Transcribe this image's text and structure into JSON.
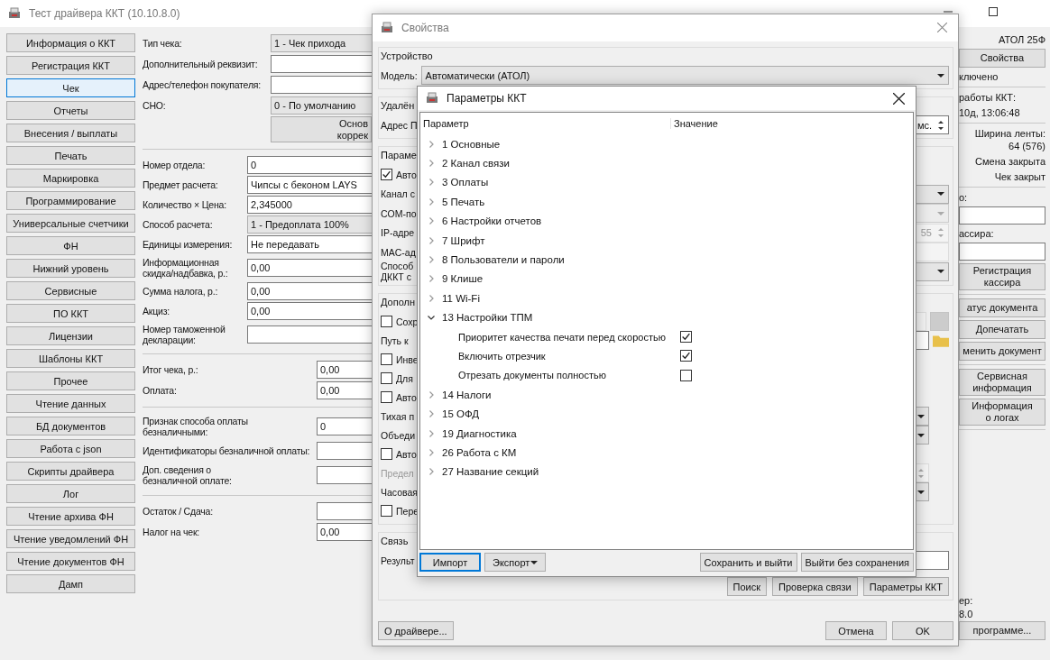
{
  "main_window": {
    "title": "Тест драйвера ККТ (10.10.8.0)",
    "nav": [
      {
        "label": "Информация о ККТ",
        "selected": false
      },
      {
        "label": "Регистрация ККТ",
        "selected": false
      },
      {
        "label": "Чек",
        "selected": true
      },
      {
        "label": "Отчеты",
        "selected": false
      },
      {
        "label": "Внесения / выплаты",
        "selected": false
      },
      {
        "label": "Печать",
        "selected": false
      },
      {
        "label": "Маркировка",
        "selected": false
      },
      {
        "label": "Программирование",
        "selected": false
      },
      {
        "label": "Универсальные счетчики",
        "selected": false
      },
      {
        "label": "ФН",
        "selected": false
      },
      {
        "label": "Нижний уровень",
        "selected": false
      },
      {
        "label": "Сервисные",
        "selected": false
      },
      {
        "label": "ПО ККТ",
        "selected": false
      },
      {
        "label": "Лицензии",
        "selected": false
      },
      {
        "label": "Шаблоны ККТ",
        "selected": false
      },
      {
        "label": "Прочее",
        "selected": false
      },
      {
        "label": "Чтение данных",
        "selected": false
      },
      {
        "label": "БД документов",
        "selected": false
      },
      {
        "label": "Работа с json",
        "selected": false
      },
      {
        "label": "Скрипты драйвера",
        "selected": false
      },
      {
        "label": "Лог",
        "selected": false
      },
      {
        "label": "Чтение архива ФН",
        "selected": false
      },
      {
        "label": "Чтение уведомлений ФН",
        "selected": false
      },
      {
        "label": "Чтение документов ФН",
        "selected": false
      },
      {
        "label": "Дамп",
        "selected": false
      }
    ],
    "form_groups": [
      {
        "rows": [
          {
            "label": "Тип чека:",
            "kind": "combo",
            "value": "1 - Чек прихода"
          },
          {
            "label": "Дополнительный реквизит:",
            "kind": "input"
          },
          {
            "label": "Адрес/телефон покупателя:",
            "kind": "input"
          },
          {
            "label": "СНО:",
            "kind": "combo",
            "value": "0 - По умолчанию"
          }
        ],
        "button": "Основ\nкоррек"
      },
      {
        "rows": [
          {
            "label": "Номер отдела:",
            "kind": "input",
            "value": "0"
          },
          {
            "label": "Предмет расчета:",
            "kind": "input",
            "value": "Чипсы с беконом LAYS"
          },
          {
            "label": "Количество × Цена:",
            "kind": "input",
            "value": "2,345000"
          },
          {
            "label": "Способ расчета:",
            "kind": "combo",
            "value": "1 - Предоплата 100%"
          },
          {
            "label": "Единицы измерения:",
            "kind": "input",
            "value": "Не передавать"
          },
          {
            "label": "Информационная\nскидка/надбавка, р.:",
            "kind": "input",
            "value": "0,00"
          },
          {
            "label": "Сумма налога, р.:",
            "kind": "input",
            "value": "0,00"
          },
          {
            "label": "Акциз:",
            "kind": "input",
            "value": "0,00"
          },
          {
            "label": "Номер таможенной\nдекларации:",
            "kind": "input"
          }
        ]
      },
      {
        "rows": [
          {
            "label": "Итог чека, р.:",
            "kind": "input",
            "value": "0,00"
          },
          {
            "label": "Оплата:",
            "kind": "input",
            "value": "0,00"
          }
        ]
      },
      {
        "rows": [
          {
            "label": "Признак способа оплаты\nбезналичными:",
            "kind": "input",
            "value": "0"
          },
          {
            "label": "Идентификаторы безналичной оплаты:",
            "kind": "input"
          },
          {
            "label": "Доп. сведения о\nбезналичной оплате:",
            "kind": "input"
          }
        ]
      },
      {
        "rows": [
          {
            "label": "Остаток / Сдача:",
            "kind": "input"
          },
          {
            "label": "Налог на чек:",
            "kind": "input",
            "value": "0,00"
          }
        ]
      }
    ],
    "right_panel": [
      [
        {
          "kind": "text_right",
          "text": "АТОЛ 25Ф"
        },
        {
          "kind": "button",
          "text": "Свойства"
        },
        {
          "kind": "text",
          "text": "ключено"
        }
      ],
      [
        {
          "kind": "text",
          "text": "работы ККТ:"
        },
        {
          "kind": "text",
          "text": "10д, 13:06:48"
        }
      ],
      [
        {
          "kind": "text_right",
          "text": "Ширина ленты:\n64 (576)"
        },
        {
          "kind": "text_right",
          "text": "Смена закрыта"
        },
        {
          "kind": "text_right",
          "text": "Чек закрыт"
        }
      ],
      [
        {
          "kind": "text",
          "text": "о:"
        },
        {
          "kind": "input"
        },
        {
          "kind": "text",
          "text": "ассира:"
        },
        {
          "kind": "input"
        },
        {
          "kind": "button",
          "text": "Регистрация\nкассира"
        }
      ],
      [
        {
          "kind": "button",
          "text": "атус документа"
        },
        {
          "kind": "button",
          "text": "Допечатать"
        },
        {
          "kind": "button",
          "text": "менить документ"
        }
      ],
      [
        {
          "kind": "button",
          "text": "Сервисная\nинформация"
        },
        {
          "kind": "button",
          "text": "Информация\nо логах"
        }
      ]
    ],
    "right_footer": [
      {
        "kind": "text",
        "text": "ер:"
      },
      {
        "kind": "text",
        "text": "8.0"
      },
      {
        "kind": "button",
        "text": "программе..."
      }
    ]
  },
  "properties_dialog": {
    "title": "Свойства",
    "groups": [
      {
        "title": "Устройство",
        "rows": [
          {
            "kind": "label",
            "label": "Модель:",
            "control": {
              "kind": "combo",
              "value": "Автоматически (АТОЛ)"
            }
          }
        ]
      },
      {
        "title": "Удалён",
        "rows": [
          {
            "kind": "label",
            "label": "Адрес П",
            "control": {
              "kind": "spin",
              "value": "мс."
            }
          }
        ]
      },
      {
        "title": "Параме",
        "rows": [
          {
            "kind": "checkbox",
            "label": "Авто",
            "checked": true
          },
          {
            "kind": "label",
            "label": "Канал с",
            "control": {
              "kind": "combo"
            }
          },
          {
            "kind": "label",
            "label": "COM-по",
            "control": {
              "kind": "combo",
              "disabled": true
            }
          },
          {
            "kind": "label",
            "label": "IP-адре",
            "control": {
              "kind": "spin",
              "value": "55",
              "disabled": true
            }
          },
          {
            "kind": "label",
            "label": "MAC-ад",
            "control": {
              "kind": "input",
              "disabled": true
            }
          },
          {
            "kind": "label",
            "label": "Способ\nДККТ с",
            "control": {
              "kind": "combo"
            }
          }
        ]
      },
      {
        "title": "Дополн",
        "rows": [
          {
            "kind": "checkbox",
            "label": "Сохр",
            "checked": false,
            "control": {
              "kind": "input_button",
              "disabled": true
            }
          },
          {
            "kind": "label",
            "label": "Путь к",
            "control": {
              "kind": "input_folder"
            }
          },
          {
            "kind": "checkbox",
            "label": "Инве",
            "checked": false
          },
          {
            "kind": "checkbox",
            "label": "Для",
            "checked": false
          },
          {
            "kind": "checkbox",
            "label": "Авто",
            "checked": false
          },
          {
            "kind": "label",
            "label": "Тихая п",
            "control": {
              "kind": "combo"
            }
          },
          {
            "kind": "label",
            "label": "Объеди",
            "control": {
              "kind": "combo"
            }
          },
          {
            "kind": "checkbox",
            "label": "Авто",
            "checked": false
          },
          {
            "kind": "label",
            "label": "Предел",
            "disabled": true,
            "control": {
              "kind": "spin",
              "disabled": true
            }
          },
          {
            "kind": "label",
            "label": "Часовая",
            "control": {
              "kind": "combo"
            }
          },
          {
            "kind": "checkbox",
            "label": "Пере",
            "checked": false
          }
        ]
      },
      {
        "title": "Связь",
        "rows": [
          {
            "kind": "label",
            "label": "Результ",
            "control": {
              "kind": "input"
            }
          }
        ],
        "buttons": [
          "Поиск",
          "Проверка связи",
          "Параметры ККТ"
        ]
      }
    ],
    "about_button": "О драйвере...",
    "buttons": [
      "Отмена",
      "OK"
    ]
  },
  "params_dialog": {
    "title": "Параметры ККТ",
    "columns": [
      "Параметр",
      "Значение"
    ],
    "tree": [
      {
        "label": "1 Основные",
        "expanded": false
      },
      {
        "label": "2 Канал связи",
        "expanded": false
      },
      {
        "label": "3 Оплаты",
        "expanded": false
      },
      {
        "label": "5 Печать",
        "expanded": false
      },
      {
        "label": "6 Настройки отчетов",
        "expanded": false
      },
      {
        "label": "7 Шрифт",
        "expanded": false
      },
      {
        "label": "8 Пользователи и пароли",
        "expanded": false
      },
      {
        "label": "9 Клише",
        "expanded": false
      },
      {
        "label": "11 Wi-Fi",
        "expanded": false
      },
      {
        "label": "13 Настройки ТПМ",
        "expanded": true,
        "children": [
          {
            "label": "Приоритет качества печати перед скоростью",
            "checked": true
          },
          {
            "label": "Включить отрезчик",
            "checked": true
          },
          {
            "label": "Отрезать документы полностью",
            "checked": false
          }
        ]
      },
      {
        "label": "14 Налоги",
        "expanded": false
      },
      {
        "label": "15 ОФД",
        "expanded": false
      },
      {
        "label": "19 Диагностика",
        "expanded": false
      },
      {
        "label": "26 Работа с КМ",
        "expanded": false
      },
      {
        "label": "27 Название секций",
        "expanded": false
      }
    ],
    "left_buttons": [
      {
        "label": "Импорт",
        "kind": "default"
      },
      {
        "label": "Экспорт",
        "kind": "menu"
      }
    ],
    "right_buttons": [
      "Сохранить и выйти",
      "Выйти без сохранения"
    ]
  }
}
